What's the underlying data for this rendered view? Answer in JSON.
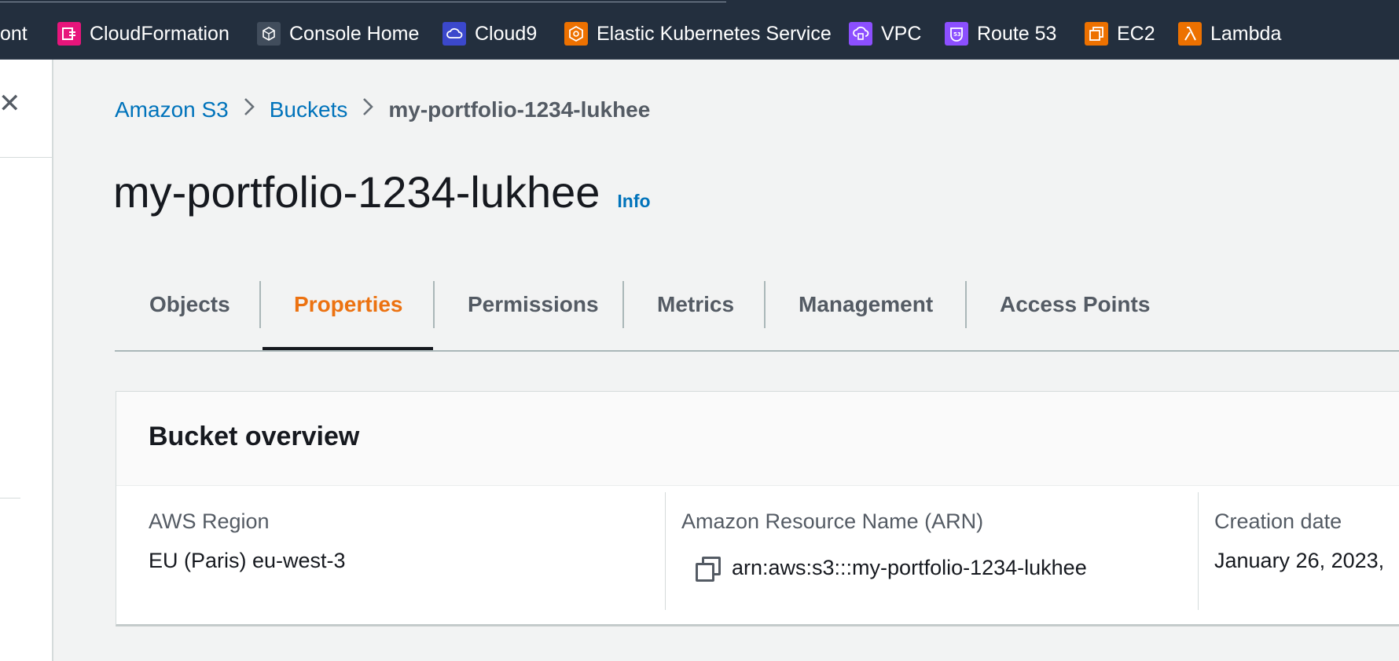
{
  "favorites": [
    {
      "label": "ont",
      "icon": "",
      "color": ""
    },
    {
      "label": "CloudFormation",
      "icon": "cloudformation-icon",
      "color": "#e7157b"
    },
    {
      "label": "Console Home",
      "icon": "console-home-icon",
      "color": "#414d5c"
    },
    {
      "label": "Cloud9",
      "icon": "cloud9-icon",
      "color": "#3b48cc"
    },
    {
      "label": "Elastic Kubernetes Service",
      "icon": "eks-icon",
      "color": "#ed7100"
    },
    {
      "label": "VPC",
      "icon": "vpc-icon",
      "color": "#8c4fff"
    },
    {
      "label": "Route 53",
      "icon": "route53-icon",
      "color": "#8c4fff"
    },
    {
      "label": "EC2",
      "icon": "ec2-icon",
      "color": "#ed7100"
    },
    {
      "label": "Lambda",
      "icon": "lambda-icon",
      "color": "#ed7100"
    }
  ],
  "breadcrumb": {
    "items": [
      "Amazon S3",
      "Buckets"
    ],
    "current": "my-portfolio-1234-lukhee"
  },
  "page": {
    "title": "my-portfolio-1234-lukhee",
    "info_label": "Info"
  },
  "tabs": [
    {
      "label": "Objects",
      "active": false
    },
    {
      "label": "Properties",
      "active": true
    },
    {
      "label": "Permissions",
      "active": false
    },
    {
      "label": "Metrics",
      "active": false
    },
    {
      "label": "Management",
      "active": false
    },
    {
      "label": "Access Points",
      "active": false
    }
  ],
  "overview": {
    "title": "Bucket overview",
    "region_label": "AWS Region",
    "region_value": "EU (Paris) eu-west-3",
    "arn_label": "Amazon Resource Name (ARN)",
    "arn_value": "arn:aws:s3:::my-portfolio-1234-lukhee",
    "creation_label": "Creation date",
    "creation_value": "January 26, 2023,"
  },
  "colors": {
    "accent": "#ec7211",
    "link": "#0073bb",
    "topbar": "#232f3e"
  }
}
